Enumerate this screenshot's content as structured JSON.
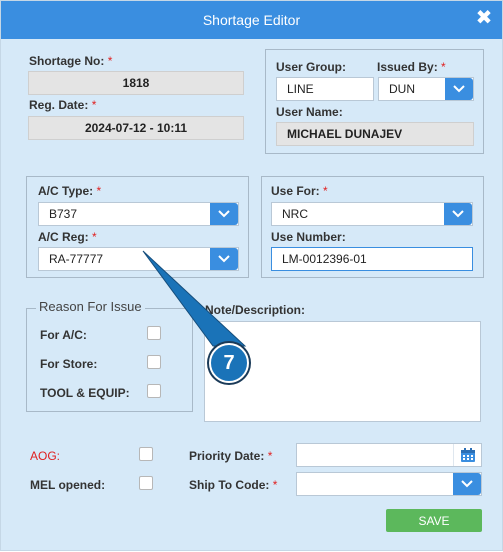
{
  "dialog": {
    "title": "Shortage Editor",
    "close_glyph": "✖"
  },
  "shortage": {
    "no_label": "Shortage No:",
    "no_value": "1818",
    "reg_date_label": "Reg. Date:",
    "reg_date_value": "2024-07-12 - 10:11"
  },
  "user": {
    "group_label": "User Group:",
    "group_value": "LINE",
    "issued_by_label": "Issued By:",
    "issued_by_value": "DUN",
    "name_label": "User Name:",
    "name_value": "MICHAEL DUNAJEV"
  },
  "aircraft": {
    "type_label": "A/C Type:",
    "type_value": "B737",
    "reg_label": "A/C Reg:",
    "reg_value": "RA-77777"
  },
  "use": {
    "for_label": "Use For:",
    "for_value": "NRC",
    "number_label": "Use Number:",
    "number_value": "LM-0012396-01"
  },
  "reason": {
    "legend": "Reason For Issue",
    "for_ac": "For A/C:",
    "for_store": "For Store:",
    "tool_equip": "TOOL & EQUIP:"
  },
  "note": {
    "label": "Note/Description:",
    "value": ""
  },
  "bottom": {
    "aog_label": "AOG:",
    "mel_label": "MEL opened:",
    "priority_label": "Priority Date:",
    "priority_value": "",
    "ship_to_label": "Ship To Code:",
    "ship_to_value": "",
    "save_label": "SAVE"
  },
  "required_mark": "*",
  "callout": {
    "number": "7"
  },
  "colors": {
    "accent": "#3a8ee0",
    "save": "#5cb85c",
    "required": "#e02020",
    "badge": "#1a73b8"
  }
}
